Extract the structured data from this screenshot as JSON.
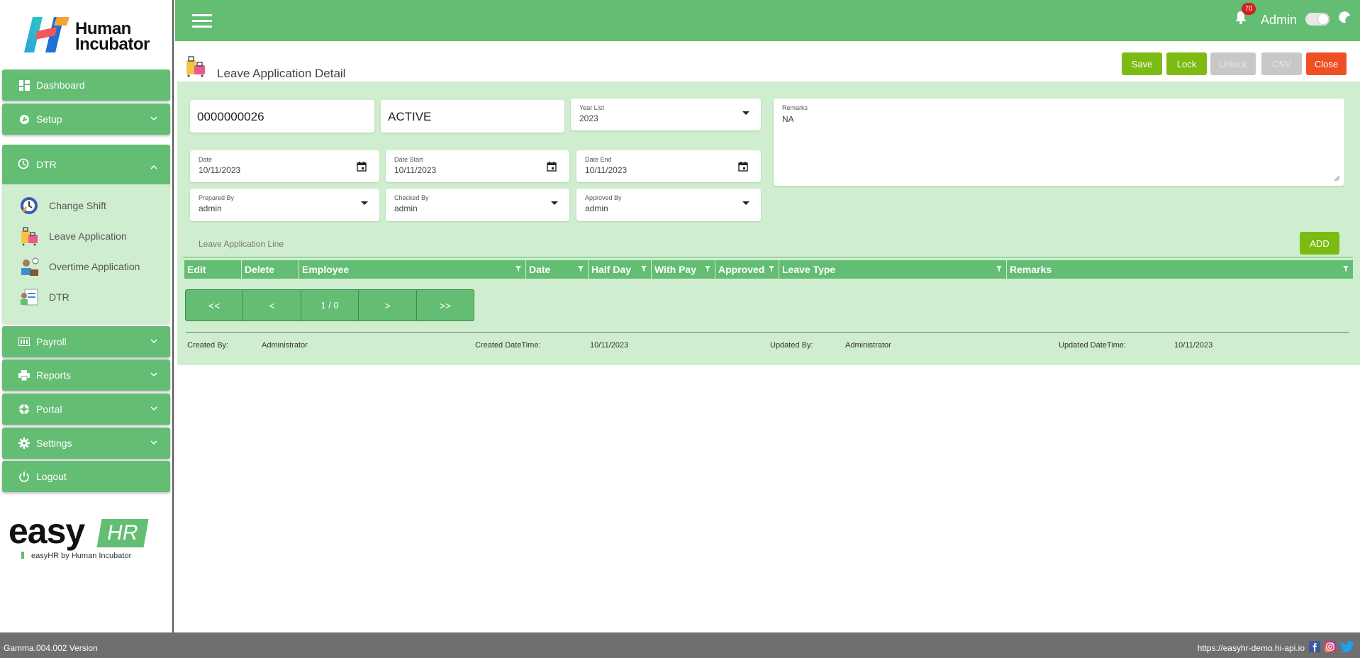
{
  "brand": {
    "logo_text_line1": "Human",
    "logo_text_line2": "Incubator",
    "easy_word": "easy",
    "hr_word": "HR",
    "easy_sub": "easyHR by Human Incubator"
  },
  "sidebar": {
    "items": [
      {
        "label": "Dashboard",
        "icon": "dashboard-icon"
      },
      {
        "label": "Setup",
        "icon": "wrench-icon"
      },
      {
        "label": "DTR",
        "icon": "clock-icon"
      },
      {
        "label": "Payroll",
        "icon": "payroll-icon"
      },
      {
        "label": "Reports",
        "icon": "printer-icon"
      },
      {
        "label": "Portal",
        "icon": "aperture-icon"
      },
      {
        "label": "Settings",
        "icon": "gear-icon"
      },
      {
        "label": "Logout",
        "icon": "power-icon"
      }
    ],
    "dtr_sub": [
      {
        "label": "Change Shift",
        "icon": "change-shift-icon"
      },
      {
        "label": "Leave Application",
        "icon": "luggage-icon"
      },
      {
        "label": "Overtime Application",
        "icon": "overtime-icon"
      },
      {
        "label": "DTR",
        "icon": "dtr-card-icon"
      }
    ]
  },
  "topbar": {
    "notification_count": "70",
    "user": "Admin"
  },
  "page": {
    "title": "Leave Application Detail"
  },
  "toolbar": {
    "save": "Save",
    "lock": "Lock",
    "unlock": "Unlock",
    "csv": "CSV",
    "close": "Close"
  },
  "colors": {
    "accent": "#63bd73",
    "panel": "#cfeecf",
    "save_lock": "#7cbb12",
    "close": "#f04e23",
    "disabled": "#c8c8c8",
    "footer": "#6f6f6f"
  },
  "form": {
    "number": "0000000026",
    "status": "ACTIVE",
    "year_list": {
      "label": "Year List",
      "value": "2023"
    },
    "remarks": {
      "label": "Remarks",
      "value": "NA"
    },
    "date": {
      "label": "Date",
      "value": "10/11/2023"
    },
    "date_start": {
      "label": "Date Start",
      "value": "10/11/2023"
    },
    "date_end": {
      "label": "Date End",
      "value": "10/11/2023"
    },
    "prepared_by": {
      "label": "Prepared By",
      "value": "admin"
    },
    "checked_by": {
      "label": "Checked By",
      "value": "admin"
    },
    "approved_by": {
      "label": "Approved By",
      "value": "admin"
    }
  },
  "lines": {
    "label": "Leave Application Line",
    "add": "ADD",
    "columns": [
      "Edit",
      "Delete",
      "Employee",
      "Date",
      "Half Day",
      "With Pay",
      "Approved",
      "Leave Type",
      "Remarks"
    ],
    "pager": {
      "first": "<<",
      "prev": "<",
      "info": "1 / 0",
      "next": ">",
      "last": ">>"
    }
  },
  "audit": {
    "created_by_label": "Created By:",
    "created_by": "Administrator",
    "created_dt_label": "Created DateTime:",
    "created_dt": "10/11/2023",
    "updated_by_label": "Updated By:",
    "updated_by": "Administrator",
    "updated_dt_label": "Updated DateTime:",
    "updated_dt": "10/11/2023"
  },
  "footer": {
    "version": "Gamma.004.002 Version",
    "url": "https://easyhr-demo.hi-api.io",
    "socials": [
      "facebook-icon",
      "instagram-icon",
      "twitter-icon"
    ]
  }
}
